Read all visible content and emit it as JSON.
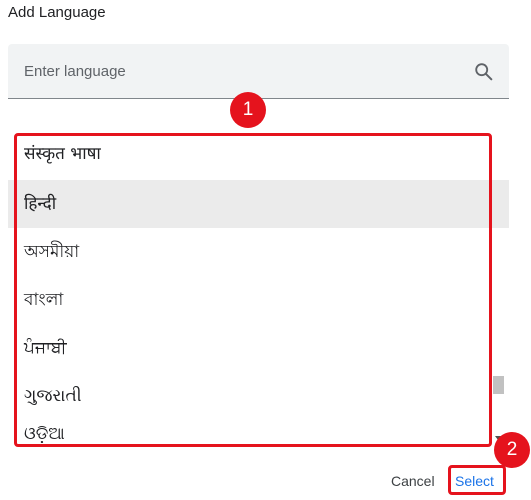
{
  "dialog": {
    "title": "Add Language"
  },
  "search": {
    "placeholder": "Enter language",
    "value": "",
    "icon": "search-icon"
  },
  "languages": {
    "items": [
      {
        "label": "संस्कृत भाषा",
        "selected": false
      },
      {
        "label": "हिन्दी",
        "selected": true
      },
      {
        "label": "অসমীয়া",
        "selected": false
      },
      {
        "label": "বাংলা",
        "selected": false
      },
      {
        "label": "ਪੰਜਾਬੀ",
        "selected": false
      },
      {
        "label": "ગુજરાતી",
        "selected": false
      },
      {
        "label": "ଓଡ଼ିଆ",
        "selected": false
      }
    ]
  },
  "annotations": {
    "step1": "1",
    "step2": "2",
    "highlight_color": "#e5131d"
  },
  "buttons": {
    "cancel": "Cancel",
    "select": "Select"
  },
  "colors": {
    "accent": "#1a73e8",
    "selected_row": "#ebebeb",
    "search_bg": "#f1f3f4"
  }
}
